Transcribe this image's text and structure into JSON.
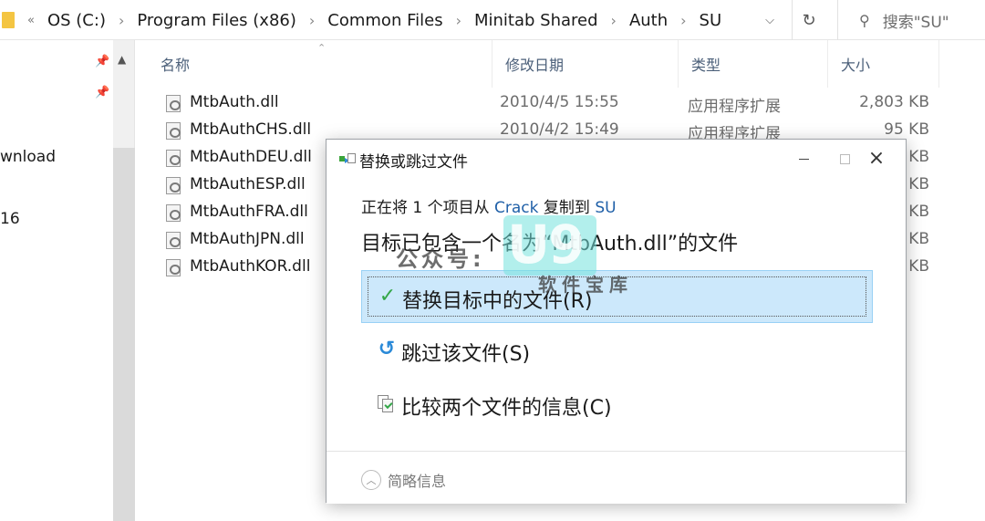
{
  "address_bar": {
    "overflow_marker": "«",
    "crumbs": [
      "OS (C:)",
      "Program Files (x86)",
      "Common Files",
      "Minitab Shared",
      "Auth",
      "SU"
    ],
    "search_placeholder": "搜索\"SU\""
  },
  "nav_pane": {
    "items": [
      "wnload",
      "16"
    ]
  },
  "file_list": {
    "columns": {
      "name": "名称",
      "modified": "修改日期",
      "type": "类型",
      "size": "大小"
    },
    "rows": [
      {
        "name": "MtbAuth.dll",
        "modified": "2010/4/5 15:55",
        "type": "应用程序扩展",
        "size": "2,803 KB"
      },
      {
        "name": "MtbAuthCHS.dll",
        "modified": "2010/4/2 15:49",
        "type": "应用程序扩展",
        "size": "95 KB"
      },
      {
        "name": "MtbAuthDEU.dll",
        "modified": "",
        "type": "",
        "size": "KB"
      },
      {
        "name": "MtbAuthESP.dll",
        "modified": "",
        "type": "",
        "size": "KB"
      },
      {
        "name": "MtbAuthFRA.dll",
        "modified": "",
        "type": "",
        "size": "KB"
      },
      {
        "name": "MtbAuthJPN.dll",
        "modified": "",
        "type": "",
        "size": "KB"
      },
      {
        "name": "MtbAuthKOR.dll",
        "modified": "",
        "type": "",
        "size": "KB"
      }
    ]
  },
  "dialog": {
    "title": "替换或跳过文件",
    "info_prefix": "正在将 1 个项目从 ",
    "info_source": "Crack",
    "info_middle": " 复制到 ",
    "info_dest": "SU",
    "heading": "目标已包含一个名为“MtbAuth.dll”的文件",
    "options": {
      "replace": "替换目标中的文件(R)",
      "skip": "跳过该文件(S)",
      "compare": "比较两个文件的信息(C)"
    },
    "footer": "简略信息"
  },
  "watermark": {
    "text": "公众号:",
    "logo": "U9",
    "sub": "软件宝库"
  }
}
